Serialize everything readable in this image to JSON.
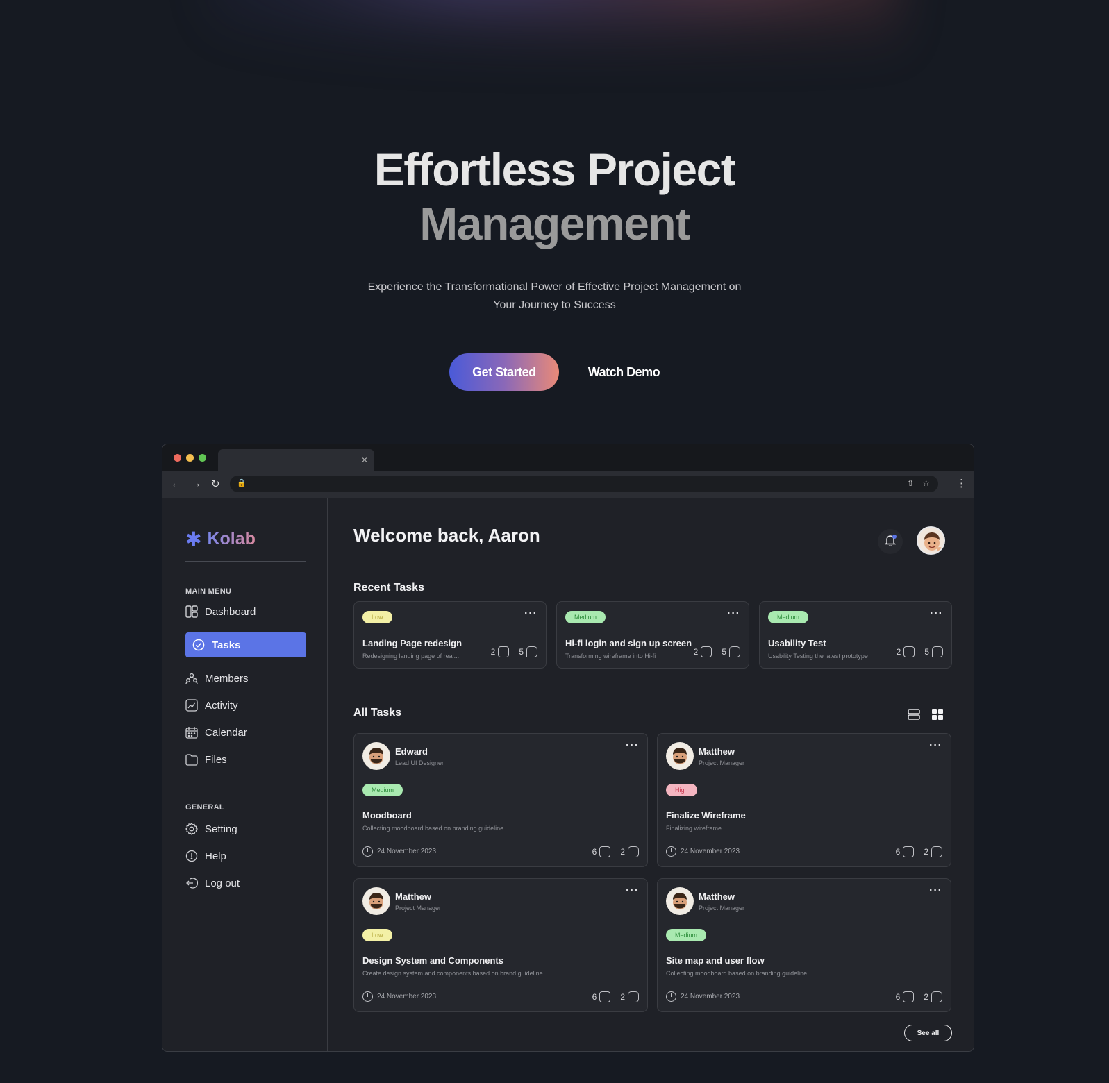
{
  "hero": {
    "title_line1": "Effortless Project",
    "title_line2": "Management",
    "subtitle": "Experience the Transformational Power of Effective Project Management on Your Journey to Success",
    "primary_cta": "Get Started",
    "secondary_cta": "Watch Demo"
  },
  "browser": {
    "tab_close": "×",
    "dot_colors": [
      "#ed6a5e",
      "#f5bf4f",
      "#61c554"
    ]
  },
  "app": {
    "brand": "Kolab",
    "welcome": "Welcome back, Aaron",
    "sidebar": {
      "main_menu_heading": "MAIN MENU",
      "items": [
        {
          "label": "Dashboard",
          "icon": "dashboard-icon"
        },
        {
          "label": "Tasks",
          "icon": "tasks-icon",
          "active": true
        },
        {
          "label": "Members",
          "icon": "members-icon"
        },
        {
          "label": "Activity",
          "icon": "activity-icon"
        },
        {
          "label": "Calendar",
          "icon": "calendar-icon"
        },
        {
          "label": "Files",
          "icon": "files-icon"
        }
      ],
      "general_heading": "GENERAL",
      "general_items": [
        {
          "label": "Setting",
          "icon": "gear-icon"
        },
        {
          "label": "Help",
          "icon": "help-icon"
        },
        {
          "label": "Log out",
          "icon": "logout-icon"
        }
      ]
    },
    "recent_tasks": {
      "heading": "Recent Tasks",
      "items": [
        {
          "priority": "Low",
          "title": "Landing Page redesign",
          "desc": "Redesigning landing page of real...",
          "attachments": "2",
          "comments": "5"
        },
        {
          "priority": "Medium",
          "title": "Hi-fi login and sign up screen",
          "desc": "Transforming wireframe into Hi-fi",
          "attachments": "2",
          "comments": "5"
        },
        {
          "priority": "Medium",
          "title": "Usability Test",
          "desc": "Usability Testing the latest prototype",
          "attachments": "2",
          "comments": "5"
        }
      ]
    },
    "all_tasks": {
      "heading": "All Tasks",
      "items": [
        {
          "name": "Edward",
          "role": "Lead UI Designer",
          "priority": "Medium",
          "title": "Moodboard",
          "desc": "Collecting moodboard based on branding guideline",
          "date": "24 November 2023",
          "attachments": "6",
          "comments": "2"
        },
        {
          "name": "Matthew",
          "role": "Project Manager",
          "priority": "High",
          "title": "Finalize Wireframe",
          "desc": "Finalizing wireframe",
          "date": "24 November 2023",
          "attachments": "6",
          "comments": "2"
        },
        {
          "name": "Matthew",
          "role": "Project Manager",
          "priority": "Low",
          "title": "Design System and Components",
          "desc": "Create design system and components based on brand guideline",
          "date": "24 November 2023",
          "attachments": "6",
          "comments": "2"
        },
        {
          "name": "Matthew",
          "role": "Project Manager",
          "priority": "Medium",
          "title": "Site map and user flow",
          "desc": "Collecting moodboard based on branding guideline",
          "date": "24 November 2023",
          "attachments": "6",
          "comments": "2"
        }
      ],
      "see_all": "See all"
    },
    "colors": {
      "accent": "#5b74e6",
      "low": "#f3f0a6",
      "medium": "#a9e9b0",
      "high": "#f4b5c0"
    }
  }
}
